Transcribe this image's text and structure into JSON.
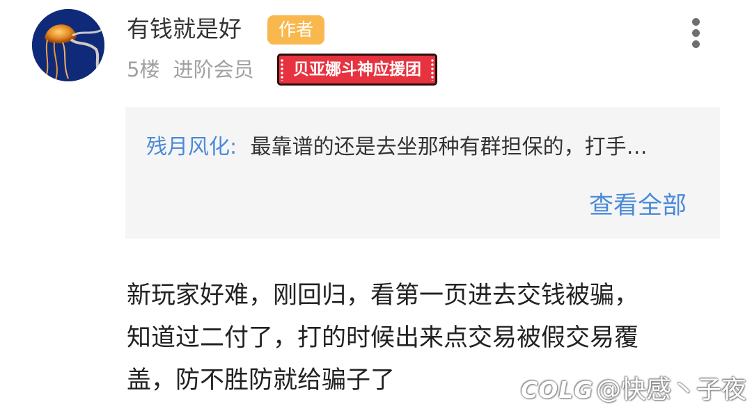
{
  "post": {
    "username": "有钱就是好",
    "author_badge": "作者",
    "floor": "5楼",
    "level": "进阶会员",
    "fan_badge": "贝亚娜斗神应援团",
    "reply_preview": {
      "author": "残月风化:",
      "text": "最靠谱的还是去坐那种有群担保的，打手…",
      "view_all": "查看全部"
    },
    "body_lines": [
      "新玩家好难，刚回归，看第一页进去交钱被骗，",
      "知道过二付了，打的时候出来点交易被假交易覆",
      "盖，防不胜防就给骗子了"
    ]
  },
  "watermark": {
    "logo": "COLG",
    "handle": "@快感丶子夜"
  },
  "icons": {
    "more": "more-vertical-icon",
    "avatar": "jellyfish-avatar"
  },
  "colors": {
    "link": "#4a8ad8",
    "author_badge": "#f8b84e",
    "fan_badge": "#e7333f",
    "reply_bg": "#f5f5f5",
    "meta_text": "#a0a0a0"
  }
}
